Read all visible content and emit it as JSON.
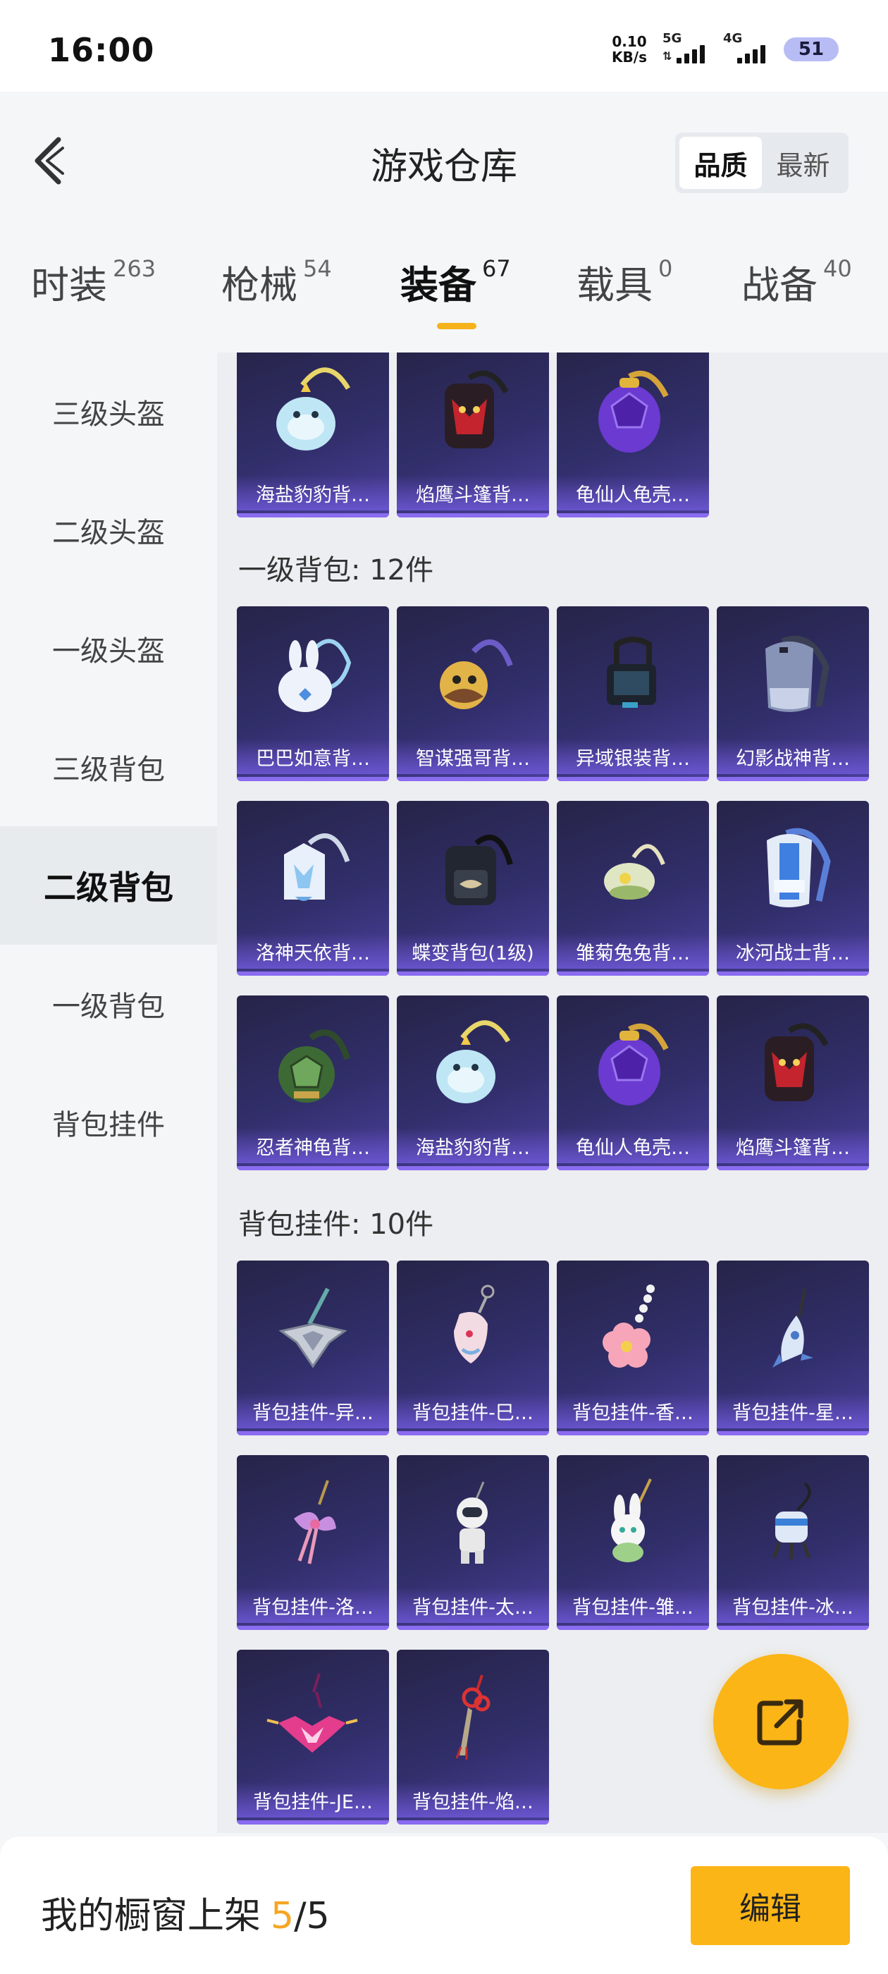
{
  "status_bar": {
    "time": "16:00",
    "net_speed_value": "0.10",
    "net_speed_unit": "KB/s",
    "signal_1_label": "5G",
    "signal_2_label": "4G",
    "battery": "51"
  },
  "header": {
    "title": "游戏仓库",
    "sort_options": [
      "品质",
      "最新"
    ],
    "sort_selected": "品质"
  },
  "categories": [
    {
      "label": "时装",
      "count": "263"
    },
    {
      "label": "枪械",
      "count": "54"
    },
    {
      "label": "装备",
      "count": "67",
      "active": true
    },
    {
      "label": "载具",
      "count": "0"
    },
    {
      "label": "战备",
      "count": "40"
    }
  ],
  "sidebar": {
    "items": [
      "三级头盔",
      "二级头盔",
      "一级头盔",
      "三级背包",
      "二级背包",
      "一级背包",
      "背包挂件"
    ],
    "active": "二级背包"
  },
  "sections": [
    {
      "title": "",
      "items": [
        "海盐豹豹背…",
        "焰鹰斗篷背…",
        "龟仙人龟壳…"
      ]
    },
    {
      "title": "一级背包: 12件",
      "items": [
        "巴巴如意背…",
        "智谋强哥背…",
        "异域银装背…",
        "幻影战神背…",
        "洛神天依背…",
        "蝶变背包(1级)",
        "雏菊兔兔背…",
        "冰河战士背…",
        "忍者神龟背…",
        "海盐豹豹背…",
        "龟仙人龟壳…",
        "焰鹰斗篷背…"
      ]
    },
    {
      "title": "背包挂件: 10件",
      "items": [
        "背包挂件-异…",
        "背包挂件-巳…",
        "背包挂件-香…",
        "背包挂件-星…",
        "背包挂件-洛…",
        "背包挂件-太…",
        "背包挂件-雏…",
        "背包挂件-冰…",
        "背包挂件-JE…",
        "背包挂件-焰…"
      ]
    }
  ],
  "bottom_bar": {
    "shelf_label": "我的橱窗上架",
    "shelf_used": "5",
    "shelf_separator": "/",
    "shelf_total": "5",
    "edit_label": "编辑"
  },
  "colors": {
    "accent": "#fbb516",
    "card_bg": "#312e6a",
    "card_label": "#8a6cf0"
  }
}
